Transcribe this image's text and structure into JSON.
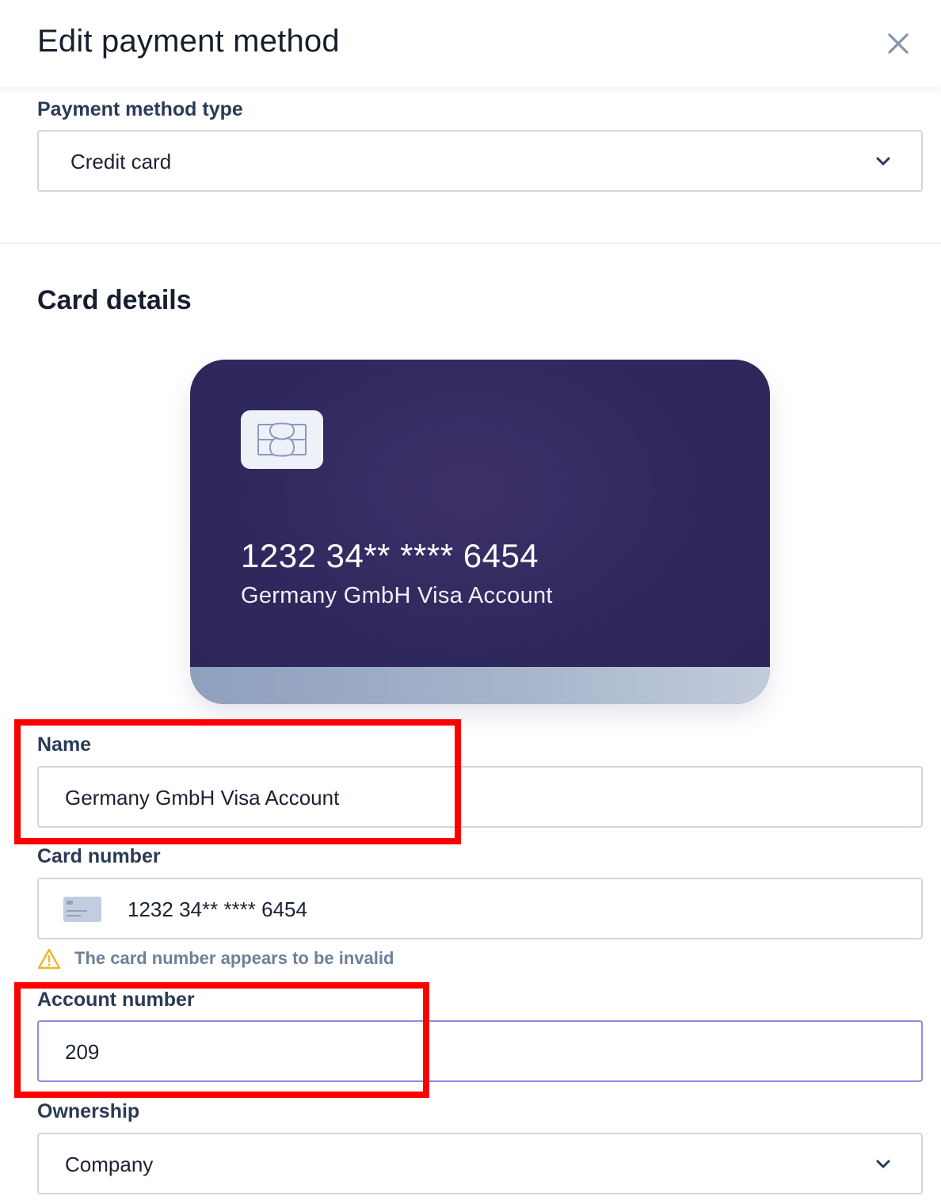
{
  "header": {
    "title": "Edit payment method"
  },
  "payment_type": {
    "label": "Payment method type",
    "value": "Credit card"
  },
  "card_details": {
    "title": "Card details",
    "card_preview": {
      "number": "1232 34** **** 6454",
      "holder": "Germany GmbH Visa Account"
    }
  },
  "form": {
    "name": {
      "label": "Name",
      "value": "Germany GmbH Visa Account"
    },
    "card_number": {
      "label": "Card number",
      "value": "1232 34** **** 6454",
      "warning": "The card number appears to be invalid"
    },
    "account_number": {
      "label": "Account number",
      "value": "209"
    },
    "ownership": {
      "label": "Ownership",
      "value": "Company"
    }
  },
  "colors": {
    "card_background": "#2f285d",
    "focus_border": "#8e8be0",
    "warning_icon": "#f0b429",
    "highlight": "#ff0000"
  },
  "icons": {
    "close": "close-icon",
    "chevron": "chevron-down-icon",
    "chip": "card-chip-icon",
    "card": "credit-card-icon",
    "warning": "warning-icon"
  }
}
